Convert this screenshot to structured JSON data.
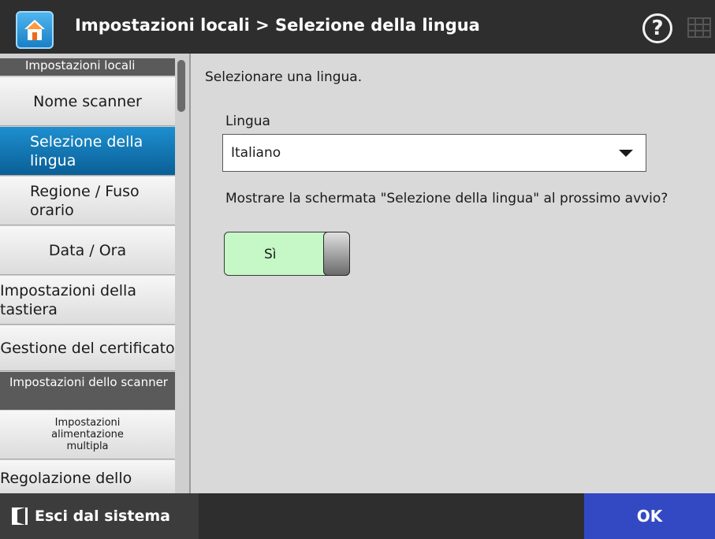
{
  "header": {
    "title": "Impostazioni locali > Selezione della lingua",
    "help_label": "?",
    "home_icon": "home-icon",
    "keyboard_icon": "keyboard-icon"
  },
  "sidebar": {
    "sections": [
      {
        "label": "Impostazioni locali"
      },
      {
        "label": "Impostazioni dello scanner"
      }
    ],
    "items": [
      {
        "label": "Nome scanner",
        "active": false
      },
      {
        "label": "Selezione della lingua",
        "active": true
      },
      {
        "label": "Regione / Fuso orario",
        "active": false
      },
      {
        "label": "Data / Ora",
        "active": false
      },
      {
        "label": "Impostazioni della tastiera",
        "active": false
      },
      {
        "label": "Gestione del certificato",
        "active": false
      },
      {
        "label": "Impostazioni alimentazione multipla",
        "active": false
      },
      {
        "label": "Regolazione dello",
        "active": false
      }
    ]
  },
  "main": {
    "instruction": "Selezionare una lingua.",
    "language_label": "Lingua",
    "language_value": "Italiano",
    "question": "Mostrare la schermata \"Selezione della lingua\" al prossimo avvio?",
    "toggle_label": "Sì",
    "toggle_on": true
  },
  "footer": {
    "logout_label": "Esci dal sistema",
    "ok_label": "OK"
  },
  "colors": {
    "header_bg": "#2e2e2e",
    "active_item": "#0a5f96",
    "toggle_on": "#c6f7c6",
    "ok_button": "#3349c4"
  }
}
